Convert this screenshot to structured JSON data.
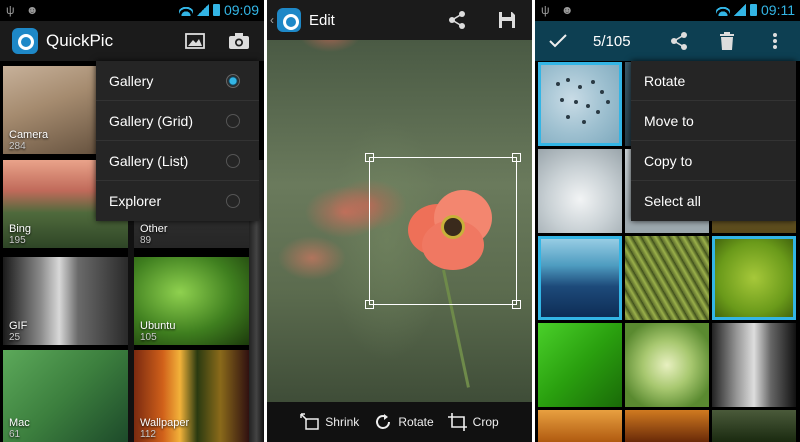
{
  "status_bar": {
    "time_left": "09:09",
    "time_right": "09:11"
  },
  "quickpic": {
    "app_title": "QuickPic",
    "albums": [
      {
        "name": "Camera",
        "count": "284"
      },
      {
        "name": "Bing",
        "count": "195"
      },
      {
        "name": "Other",
        "count": "89"
      },
      {
        "name": "GIF",
        "count": "25"
      },
      {
        "name": "Ubuntu",
        "count": "105"
      },
      {
        "name": "Mac",
        "count": "61"
      },
      {
        "name": "Wallpaper",
        "count": "112"
      }
    ],
    "view_menu": [
      {
        "label": "Gallery",
        "selected": true
      },
      {
        "label": "Gallery (Grid)",
        "selected": false
      },
      {
        "label": "Gallery (List)",
        "selected": false
      },
      {
        "label": "Explorer",
        "selected": false
      }
    ]
  },
  "editor": {
    "title": "Edit",
    "tools": [
      "Shrink",
      "Rotate",
      "Crop"
    ]
  },
  "selection": {
    "count_text": "5/105",
    "menu": [
      "Rotate",
      "Move to",
      "Copy to",
      "Select all"
    ]
  },
  "colors": {
    "accent": "#33b5e5",
    "selection_bar": "#0d3f52",
    "bar": "#1b1b1b",
    "menu_bg": "#252525"
  },
  "icons": [
    "usb-icon",
    "android-icon",
    "wifi-icon",
    "signal-icon",
    "battery-icon",
    "image-icon",
    "camera-icon",
    "back-icon",
    "share-icon",
    "save-icon",
    "checkmark-icon",
    "trash-icon",
    "overflow-menu-icon",
    "shrink-icon",
    "rotate-icon",
    "crop-icon"
  ]
}
